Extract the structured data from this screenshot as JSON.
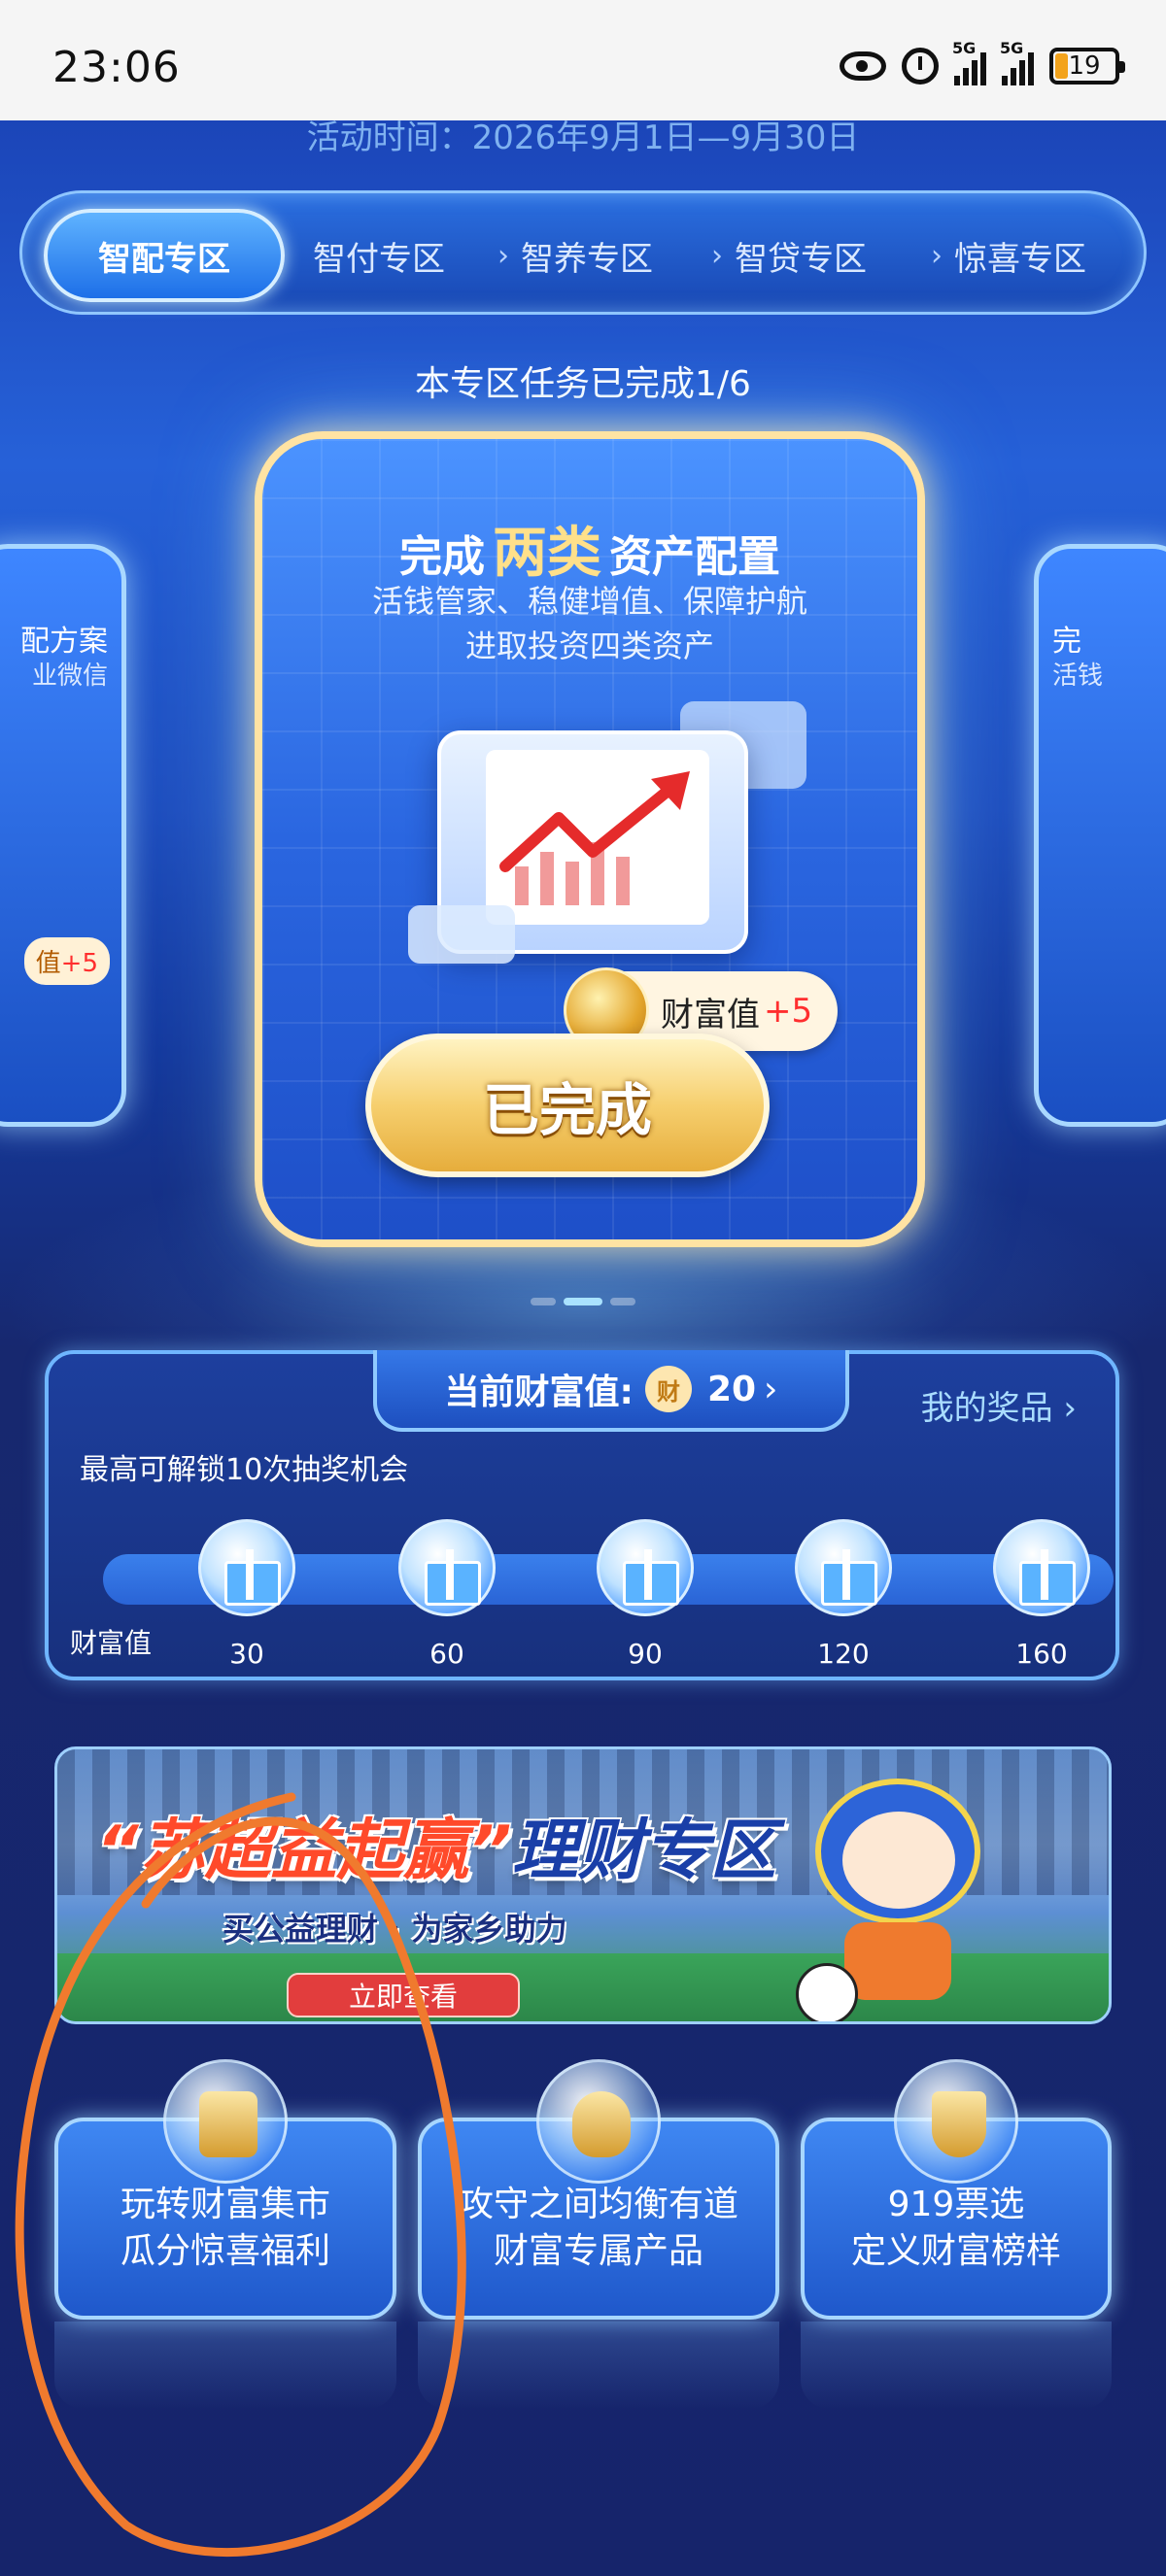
{
  "status_bar": {
    "time": "23:06",
    "network_1": "5G",
    "network_2": "5G",
    "battery": "19"
  },
  "activity_period": "活动时间：2026年9月1日—9月30日",
  "tabs": [
    {
      "label": "智配专区",
      "active": true
    },
    {
      "label": "智付专区",
      "active": false
    },
    {
      "label": "智养专区",
      "active": false
    },
    {
      "label": "智贷专区",
      "active": false
    },
    {
      "label": "惊喜专区",
      "active": false
    }
  ],
  "task_progress": "本专区任务已完成1/6",
  "side_left": {
    "line1": "配方案",
    "line2": "业微信",
    "pill_prefix": "值",
    "pill_plus": "+5"
  },
  "side_right": {
    "line1": "完",
    "line2": "活钱"
  },
  "main_card": {
    "title_prefix": "完成",
    "title_highlight": "两类",
    "title_suffix": "资产配置",
    "desc_line1": "活钱管家、稳健增值、保障护航",
    "desc_line2": "进取投资四类资产",
    "reward_label": "财富值",
    "reward_plus": "+5",
    "button_label": "已完成"
  },
  "wealth_panel": {
    "current_label": "当前财富值:",
    "coin_char": "财",
    "current_value": "20",
    "chevron": "›",
    "my_prizes": "我的奖品 ›",
    "max_note": "最高可解锁10次抽奖机会",
    "axis_label": "财富值",
    "milestones": [
      "30",
      "60",
      "90",
      "120",
      "160"
    ]
  },
  "banner": {
    "title_main": "“苏超益起赢”",
    "title_tail": "理财专区",
    "subtitle": "买公益理财 · 为家乡助力",
    "button": "立即查看"
  },
  "entries": [
    {
      "line1": "玩转财富集市",
      "line2": "瓜分惊喜福利",
      "icon": "wallet-icon"
    },
    {
      "line1": "攻守之间均衡有道",
      "line2": "财富专属产品",
      "icon": "money-bag-icon"
    },
    {
      "line1": "919票选",
      "line2": "定义财富榜样",
      "icon": "trophy-icon"
    }
  ],
  "colors": {
    "annotation": "#f07a2e",
    "accent_gold": "#f6cf6e",
    "primary_blue": "#2a66e0"
  }
}
